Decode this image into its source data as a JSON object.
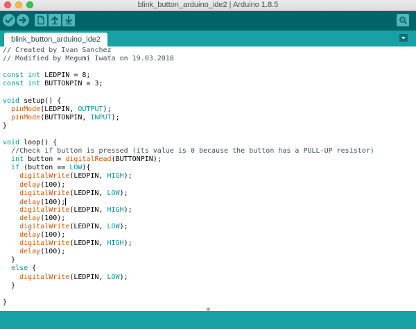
{
  "window": {
    "title": "blink_button_arduino_ide2 | Arduino 1.8.5"
  },
  "toolbar": {
    "buttons": [
      {
        "name": "verify",
        "icon": "checkmark-icon"
      },
      {
        "name": "upload",
        "icon": "arrow-right-icon"
      },
      {
        "name": "new",
        "icon": "new-file-icon"
      },
      {
        "name": "open",
        "icon": "arrow-up-icon"
      },
      {
        "name": "save",
        "icon": "arrow-down-icon"
      }
    ],
    "serial_monitor_icon": "magnifier-icon"
  },
  "tabs": [
    {
      "label": "blink_button_arduino_ide2",
      "active": true
    }
  ],
  "colors": {
    "toolbar_bg": "#006468",
    "tabbar_bg": "#17a1a5",
    "button_bg": "#4db7bb",
    "comment": "#434f54",
    "keyword": "#00979c",
    "function": "#d35400"
  },
  "code_lines": [
    [
      {
        "t": "// Created by Ivan Sanchez",
        "c": "cm"
      }
    ],
    [
      {
        "t": "// Modified by Megumi Iwata on 19.03.2018",
        "c": "cm"
      }
    ],
    [],
    [
      {
        "t": "const",
        "c": "kw"
      },
      {
        "t": " "
      },
      {
        "t": "int",
        "c": "kw"
      },
      {
        "t": " LEDPIN = 8;"
      }
    ],
    [
      {
        "t": "const",
        "c": "kw"
      },
      {
        "t": " "
      },
      {
        "t": "int",
        "c": "kw"
      },
      {
        "t": " BUTTONPIN = 3;"
      }
    ],
    [],
    [
      {
        "t": "void",
        "c": "kw"
      },
      {
        "t": " setup() {"
      }
    ],
    [
      {
        "t": "  "
      },
      {
        "t": "pinMode",
        "c": "fn"
      },
      {
        "t": "(LEDPIN, "
      },
      {
        "t": "OUTPUT",
        "c": "const"
      },
      {
        "t": ");"
      }
    ],
    [
      {
        "t": "  "
      },
      {
        "t": "pinMode",
        "c": "fn"
      },
      {
        "t": "(BUTTONPIN, "
      },
      {
        "t": "INPUT",
        "c": "const"
      },
      {
        "t": ");"
      }
    ],
    [
      {
        "t": "}"
      }
    ],
    [],
    [
      {
        "t": "void",
        "c": "kw"
      },
      {
        "t": " loop() {"
      }
    ],
    [
      {
        "t": "  //Check if button is pressed (its value is 0 because the button has a PULL-UP resistor)",
        "c": "cm"
      }
    ],
    [
      {
        "t": "  "
      },
      {
        "t": "int",
        "c": "kw"
      },
      {
        "t": " button = "
      },
      {
        "t": "digitalRead",
        "c": "fn"
      },
      {
        "t": "(BUTTONPIN);"
      }
    ],
    [
      {
        "t": "  "
      },
      {
        "t": "if",
        "c": "kw"
      },
      {
        "t": " (button == "
      },
      {
        "t": "LOW",
        "c": "const"
      },
      {
        "t": "){"
      }
    ],
    [
      {
        "t": "    "
      },
      {
        "t": "digitalWrite",
        "c": "fn"
      },
      {
        "t": "(LEDPIN, "
      },
      {
        "t": "HIGH",
        "c": "const"
      },
      {
        "t": ");"
      }
    ],
    [
      {
        "t": "    "
      },
      {
        "t": "delay",
        "c": "fn"
      },
      {
        "t": "(100);"
      }
    ],
    [
      {
        "t": "    "
      },
      {
        "t": "digitalWrite",
        "c": "fn"
      },
      {
        "t": "(LEDPIN, "
      },
      {
        "t": "LOW",
        "c": "const"
      },
      {
        "t": ");"
      }
    ],
    [
      {
        "t": "    "
      },
      {
        "t": "delay",
        "c": "fn"
      },
      {
        "t": "(100);"
      },
      {
        "caret": true
      }
    ],
    [
      {
        "t": "    "
      },
      {
        "t": "digitalWrite",
        "c": "fn"
      },
      {
        "t": "(LEDPIN, "
      },
      {
        "t": "HIGH",
        "c": "const"
      },
      {
        "t": ");"
      }
    ],
    [
      {
        "t": "    "
      },
      {
        "t": "delay",
        "c": "fn"
      },
      {
        "t": "(100);"
      }
    ],
    [
      {
        "t": "    "
      },
      {
        "t": "digitalWrite",
        "c": "fn"
      },
      {
        "t": "(LEDPIN, "
      },
      {
        "t": "LOW",
        "c": "const"
      },
      {
        "t": ");"
      }
    ],
    [
      {
        "t": "    "
      },
      {
        "t": "delay",
        "c": "fn"
      },
      {
        "t": "(100);"
      }
    ],
    [
      {
        "t": "    "
      },
      {
        "t": "digitalWrite",
        "c": "fn"
      },
      {
        "t": "(LEDPIN, "
      },
      {
        "t": "HIGH",
        "c": "const"
      },
      {
        "t": ");"
      }
    ],
    [
      {
        "t": "    "
      },
      {
        "t": "delay",
        "c": "fn"
      },
      {
        "t": "(100);"
      }
    ],
    [
      {
        "t": "  }"
      }
    ],
    [
      {
        "t": "  "
      },
      {
        "t": "else",
        "c": "kw"
      },
      {
        "t": " {"
      }
    ],
    [
      {
        "t": "    "
      },
      {
        "t": "digitalWrite",
        "c": "fn"
      },
      {
        "t": "(LEDPIN, "
      },
      {
        "t": "LOW",
        "c": "const"
      },
      {
        "t": ");"
      }
    ],
    [
      {
        "t": "  }"
      }
    ],
    [],
    [
      {
        "t": "}"
      }
    ]
  ]
}
